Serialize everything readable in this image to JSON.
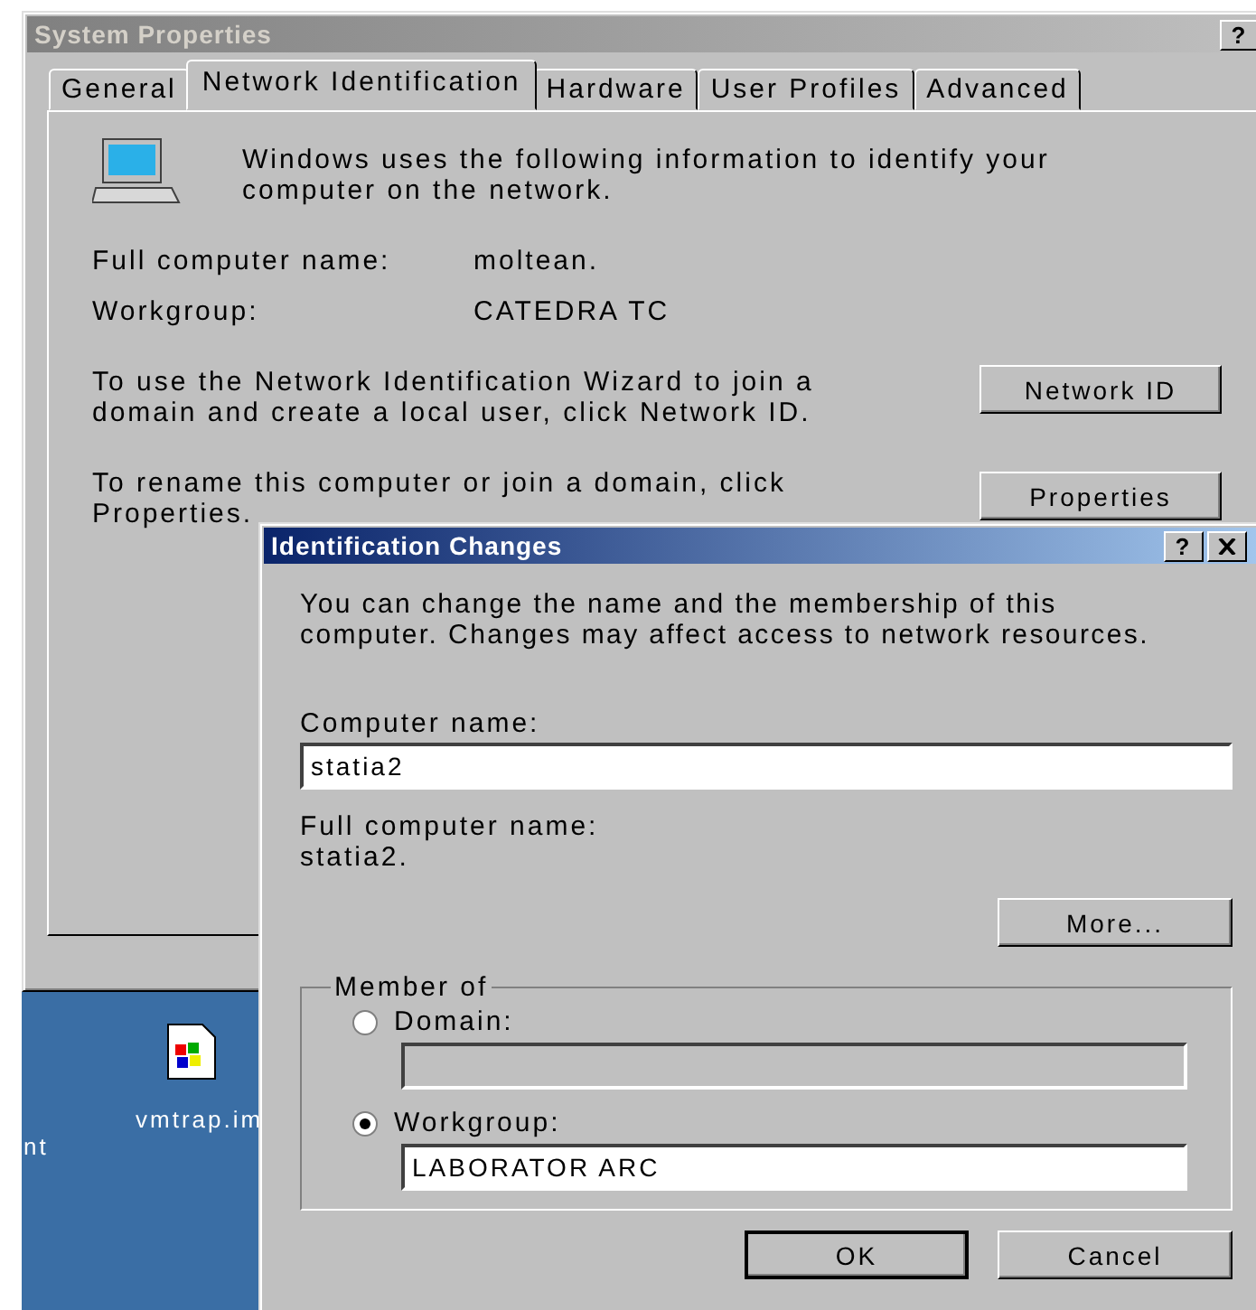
{
  "desktop": {
    "icons": [
      {
        "label_lines": [
          "nt"
        ]
      },
      {
        "label_lines": [
          "vmtrap.im"
        ]
      }
    ]
  },
  "system_properties": {
    "title": "System Properties",
    "active": false,
    "help_button": "?",
    "tabs": [
      {
        "label": "General",
        "selected": false
      },
      {
        "label": "Network Identification",
        "selected": true
      },
      {
        "label": "Hardware",
        "selected": false
      },
      {
        "label": "User Profiles",
        "selected": false
      },
      {
        "label": "Advanced",
        "selected": false
      }
    ],
    "intro": "Windows uses the following information to identify your computer on the network.",
    "fields": [
      {
        "label": "Full computer name:",
        "value": "moltean."
      },
      {
        "label": "Workgroup:",
        "value": "CATEDRA TC"
      }
    ],
    "actions": [
      {
        "text": "To use the Network Identification Wizard to join a domain and create a local user, click Network ID.",
        "button": "Network ID"
      },
      {
        "text": "To rename this computer or join a domain, click Properties.",
        "button": "Properties"
      }
    ]
  },
  "identification_changes": {
    "title": "Identification Changes",
    "active": true,
    "help_button": "?",
    "intro": "You can change the name and the membership of this computer. Changes may affect access to network resources.",
    "computer_name_label": "Computer name:",
    "computer_name": "statia2",
    "full_name_label": "Full computer name:",
    "full_name": "statia2.",
    "more_button": "More...",
    "member_of": {
      "legend": "Member of",
      "options": [
        {
          "label": "Domain:",
          "selected": false
        },
        {
          "label": "Workgroup:",
          "selected": true,
          "value": "LABORATOR ARC"
        }
      ]
    },
    "buttons": [
      "OK",
      "Cancel"
    ]
  }
}
